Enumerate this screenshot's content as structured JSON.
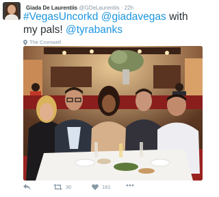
{
  "tweet": {
    "author": {
      "display_name": "Giada De Laurentiis",
      "handle": "@GDeLaurentiis",
      "separator": "·",
      "time": "22h"
    },
    "text": {
      "hashtag": "#VegasUncorkd",
      "mention1": "@giadavegas",
      "middle": " with my pals! ",
      "mention2": "@tyrabanks"
    },
    "location": "The Cromwell",
    "actions": {
      "reply_icon": "reply-icon",
      "retweet_icon": "retweet-icon",
      "retweet_count": "30",
      "like_icon": "heart-icon",
      "like_count": "181",
      "more_icon": "more-icon"
    }
  },
  "colors": {
    "link": "#1b95e0",
    "meta": "#8899a6",
    "text": "#292f33"
  }
}
